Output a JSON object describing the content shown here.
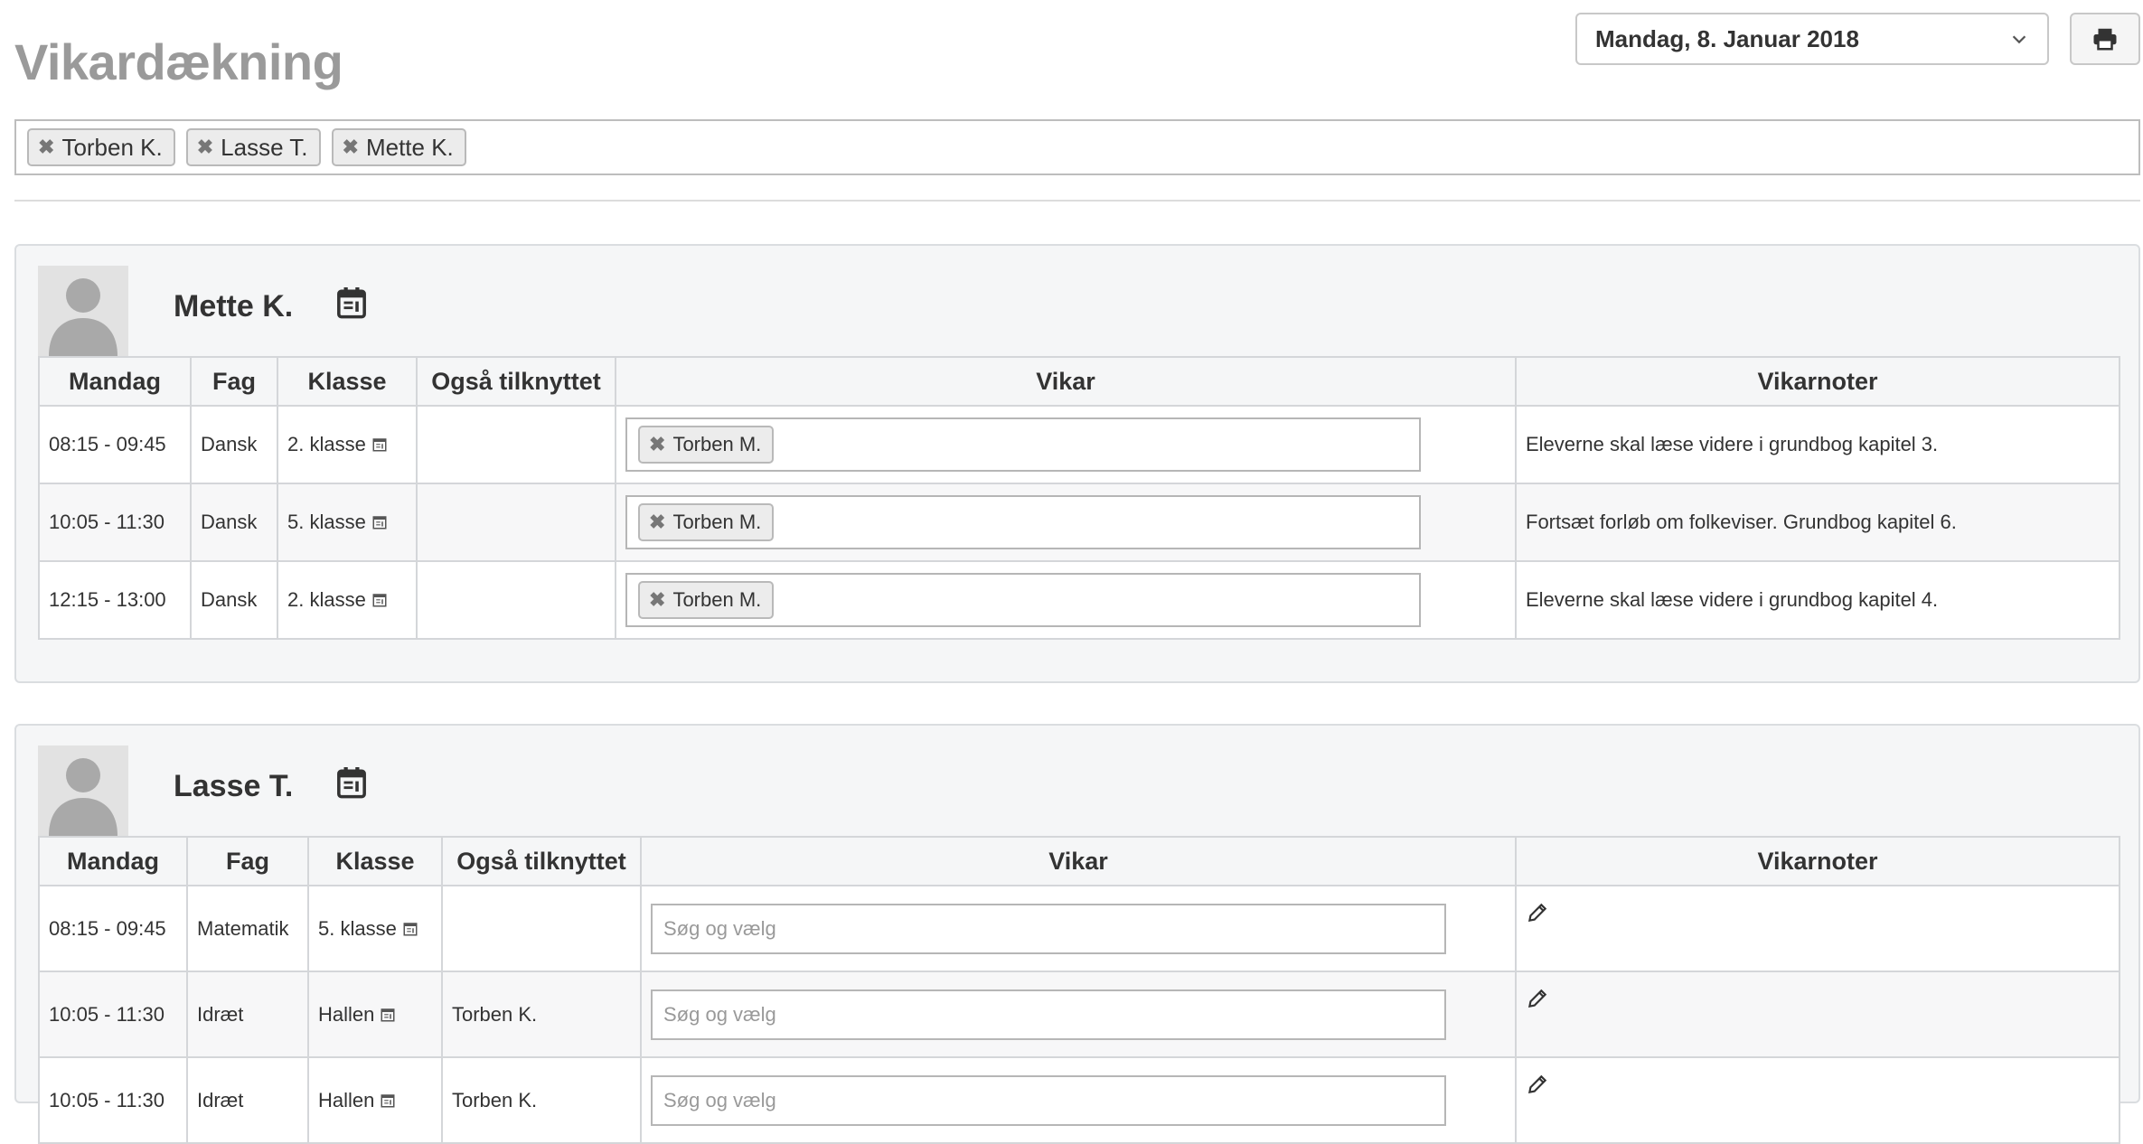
{
  "page": {
    "title": "Vikardækning"
  },
  "date_select": {
    "value": "Mandag, 8. Januar 2018"
  },
  "filter": {
    "tags": [
      "Torben K.",
      "Lasse T.",
      "Mette K."
    ]
  },
  "columns": {
    "day": "Mandag",
    "subject": "Fag",
    "class": "Klasse",
    "also": "Også tilknyttet",
    "vikar": "Vikar",
    "notes": "Vikarnoter"
  },
  "vikar_placeholder": "Søg og vælg",
  "teachers": [
    {
      "name": "Mette K.",
      "rows": [
        {
          "time": "08:15 - 09:45",
          "subject": "Dansk",
          "class": "2. klasse",
          "also": "",
          "vikar": "Torben M.",
          "note": "Eleverne skal læse videre i grundbog kapitel 3."
        },
        {
          "time": "10:05 - 11:30",
          "subject": "Dansk",
          "class": "5. klasse",
          "also": "",
          "vikar": "Torben M.",
          "note": "Fortsæt forløb om folkeviser. Grundbog kapitel 6."
        },
        {
          "time": "12:15 - 13:00",
          "subject": "Dansk",
          "class": "2. klasse",
          "also": "",
          "vikar": "Torben M.",
          "note": "Eleverne skal læse videre i grundbog kapitel 4."
        }
      ]
    },
    {
      "name": "Lasse T.",
      "rows": [
        {
          "time": "08:15 - 09:45",
          "subject": "Matematik",
          "class": "5. klasse",
          "also": ""
        },
        {
          "time": "10:05 - 11:30",
          "subject": "Idræt",
          "class": "Hallen",
          "also": "Torben K."
        },
        {
          "time": "10:05 - 11:30",
          "subject": "Idræt",
          "class": "Hallen",
          "also": "Torben K."
        }
      ]
    }
  ],
  "icons": {
    "remove": "close-icon",
    "calendar": "calendar-icon",
    "print": "printer-icon",
    "edit": "pencil-icon",
    "dropdown": "chevron-down-icon",
    "avatar": "user-silhouette-icon"
  },
  "colors": {
    "title": "#9a9a9a",
    "card_bg": "#f5f6f7",
    "tag_bg": "#ececec"
  }
}
